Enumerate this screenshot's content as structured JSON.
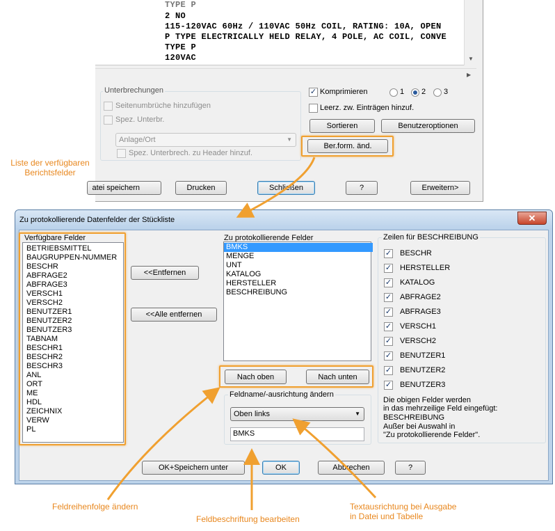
{
  "bg": {
    "text_lines": [
      "TYPE P",
      "2 NO",
      "115-120VAC 60Hz / 110VAC 50Hz COIL, RATING: 10A, OPEN",
      "P TYPE ELECTRICALLY HELD RELAY, 4 POLE, AC COIL, CONVE",
      "TYPE P",
      "120VAC"
    ],
    "interruptions_group": "Unterbrechungen",
    "page_breaks_label": "Seitenumbrüche hinzufügen",
    "spec_breaks_label": "Spez. Unterbr.",
    "location_combo_value": "Anlage/Ort",
    "spec_header_label": "Spez. Unterbrech. zu Header hinzuf.",
    "compress_label": "Komprimieren",
    "radio_options": [
      "1",
      "2",
      "3"
    ],
    "empty_entries_label": "Leerz. zw. Einträgen hinzuf.",
    "sort_button": "Sortieren",
    "user_options_button": "Benutzeroptionen",
    "report_format_button": "Ber.form. änd.",
    "save_button": "atei speichern",
    "print_button": "Drucken",
    "close_button": "Schließen",
    "help_button": "?",
    "expand_button": "Erweitern>"
  },
  "dialog": {
    "title": "Zu protokollierende Datenfelder der Stückliste",
    "available_fields_label": "Verfügbare Felder",
    "available_fields": [
      "BETRIEBSMITTEL",
      "BAUGRUPPEN-NUMMER",
      "BESCHR",
      "ABFRAGE2",
      "ABFRAGE3",
      "VERSCH1",
      "VERSCH2",
      "BENUTZER1",
      "BENUTZER2",
      "BENUTZER3",
      "TABNAM",
      "BESCHR1",
      "BESCHR2",
      "BESCHR3",
      "ANL",
      "ORT",
      "ME",
      "HDL",
      "ZEICHNIX",
      "VERW",
      "PL"
    ],
    "remove_button": "<<Entfernen",
    "remove_all_button": "<<Alle entfernen",
    "report_fields_label": "Zu protokollierende Felder",
    "report_fields": [
      "BMKS",
      "MENGE",
      "UNT",
      "KATALOG",
      "HERSTELLER",
      "BESCHREIBUNG"
    ],
    "move_up_button": "Nach oben",
    "move_down_button": "Nach unten",
    "field_name_group": "Feldname/-ausrichtung ändern",
    "alignment_value": "Oben links",
    "field_name_value": "BMKS",
    "desc_rows_group": "Zeilen für BESCHREIBUNG",
    "desc_rows": [
      "BESCHR",
      "HERSTELLER",
      "KATALOG",
      "ABFRAGE2",
      "ABFRAGE3",
      "VERSCH1",
      "VERSCH2",
      "BENUTZER1",
      "BENUTZER2",
      "BENUTZER3"
    ],
    "note_lines": [
      "Die obigen Felder werden",
      "in das mehrzeilige Feld eingefügt:",
      "BESCHREIBUNG",
      "Außer bei Auswahl in",
      "\"Zu protokollierende Felder\"."
    ],
    "ok_save_button": "OK+Speichern unter",
    "ok_button": "OK",
    "cancel_button": "Abbrechen",
    "help_button": "?",
    "close_glyph": "✕"
  },
  "callouts": {
    "list_line1": "Liste der verfügbaren",
    "list_line2": "Berichtsfelder",
    "order": "Feldreihenfolge ändern",
    "label_edit": "Feldbeschriftung bearbeiten",
    "align_line1": "Textausrichtung bei Ausgabe",
    "align_line2": "in Datei und Tabelle"
  },
  "colors": {
    "highlight": "#f0a030",
    "callout_text": "#e8871e",
    "selection": "#3399ff"
  }
}
